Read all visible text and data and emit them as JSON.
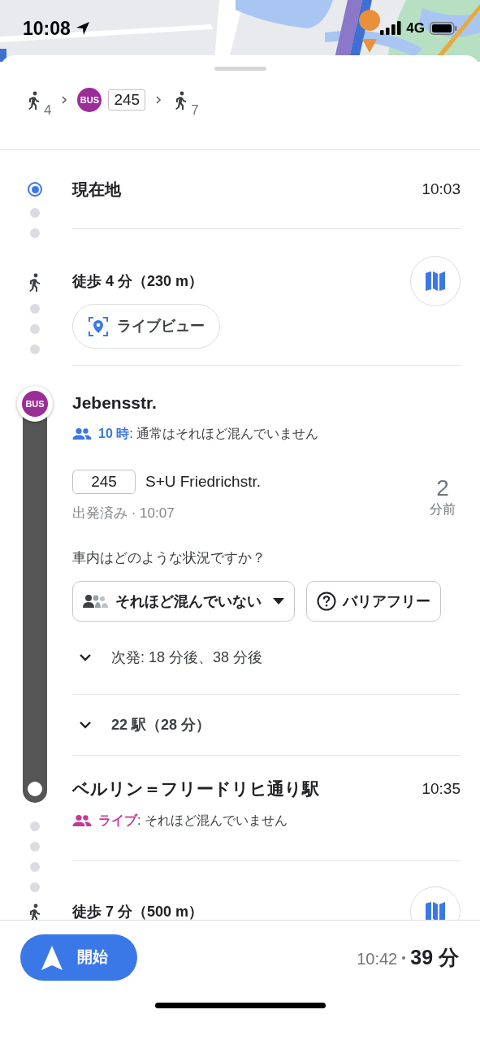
{
  "status_bar": {
    "time": "10:08",
    "network": "4G"
  },
  "summary": [
    {
      "kind": "walk",
      "minutes": "4"
    },
    {
      "kind": "bus",
      "badge": "BUS",
      "route": "245"
    },
    {
      "kind": "walk",
      "minutes": "7"
    }
  ],
  "origin": {
    "name": "現在地",
    "time": "10:03"
  },
  "walk_to_stop": {
    "text": "徒歩 4 分（230 m）",
    "live_view": "ライブビュー"
  },
  "boarding": {
    "badge": "BUS",
    "stop": "Jebensstr.",
    "crowding": {
      "highlight": "10 時",
      "text": ": 通常はそれほど混んでいません",
      "color": "#3b78e7"
    },
    "route": "245",
    "headsign": "S+U Friedrichstr.",
    "status": "出発済み · 10:07",
    "minutes": "2",
    "minutes_unit": "分前",
    "question": "車内はどのような状況ですか？",
    "chips": [
      {
        "kind": "crowding",
        "label": "それほど混んでいない"
      },
      {
        "kind": "accessibility",
        "label": "バリアフリー"
      }
    ],
    "next_departures": {
      "text": "次発: 18 分後、38 分後",
      "expanded": false
    },
    "stops": {
      "text": "22 駅（28 分）",
      "expanded": false
    }
  },
  "arrival": {
    "name": "ベルリン＝フリードリヒ通り駅",
    "time": "10:35",
    "crowding": {
      "highlight": "ライブ",
      "text": ": それほど混んでいません",
      "color": "#c2399b"
    }
  },
  "walk_to_destination": {
    "text": "徒歩 7 分（500 m）"
  },
  "footer": {
    "start": "開始",
    "arrival_time": "10:42",
    "duration": "39 分"
  }
}
